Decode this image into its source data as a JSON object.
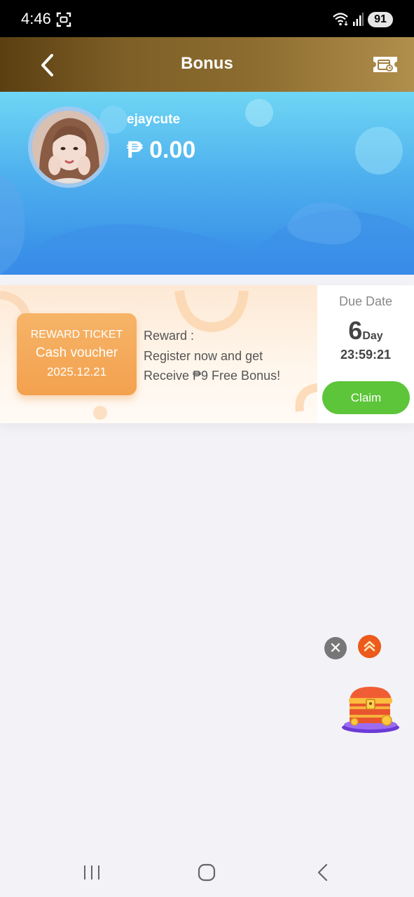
{
  "status_bar": {
    "time": "4:46",
    "battery": "91",
    "icons": [
      "screenshot-icon",
      "wifi-icon",
      "signal-icon",
      "battery-icon"
    ]
  },
  "header": {
    "title": "Bonus",
    "gradient": [
      "#5b3f12",
      "#b08f4c"
    ],
    "icons": [
      "back-arrow-icon",
      "ticket-icon"
    ]
  },
  "profile": {
    "username": "ejaycute",
    "balance": "₱ 0.00",
    "banner_colors": [
      "#6fd6f4",
      "#3489e6"
    ]
  },
  "reward": {
    "ticket_type": "REWARD TICKET",
    "ticket_name": "Cash voucher",
    "ticket_date": "2025.12.21",
    "label": "Reward :",
    "line1": "Register now and get",
    "line2": "Receive ₱9 Free Bonus!",
    "due_label": "Due Date",
    "due_days": "6",
    "due_unit": "Day",
    "due_time": "23:59:21",
    "claim_label": "Claim",
    "accent": "#f3a14e",
    "claim_color": "#5cc53a"
  },
  "floating": {
    "icons": [
      "close-icon",
      "double-chevron-up-icon",
      "treasure-chest-icon"
    ]
  },
  "nav": {
    "icons": [
      "recents-icon",
      "home-icon",
      "back-icon"
    ]
  }
}
